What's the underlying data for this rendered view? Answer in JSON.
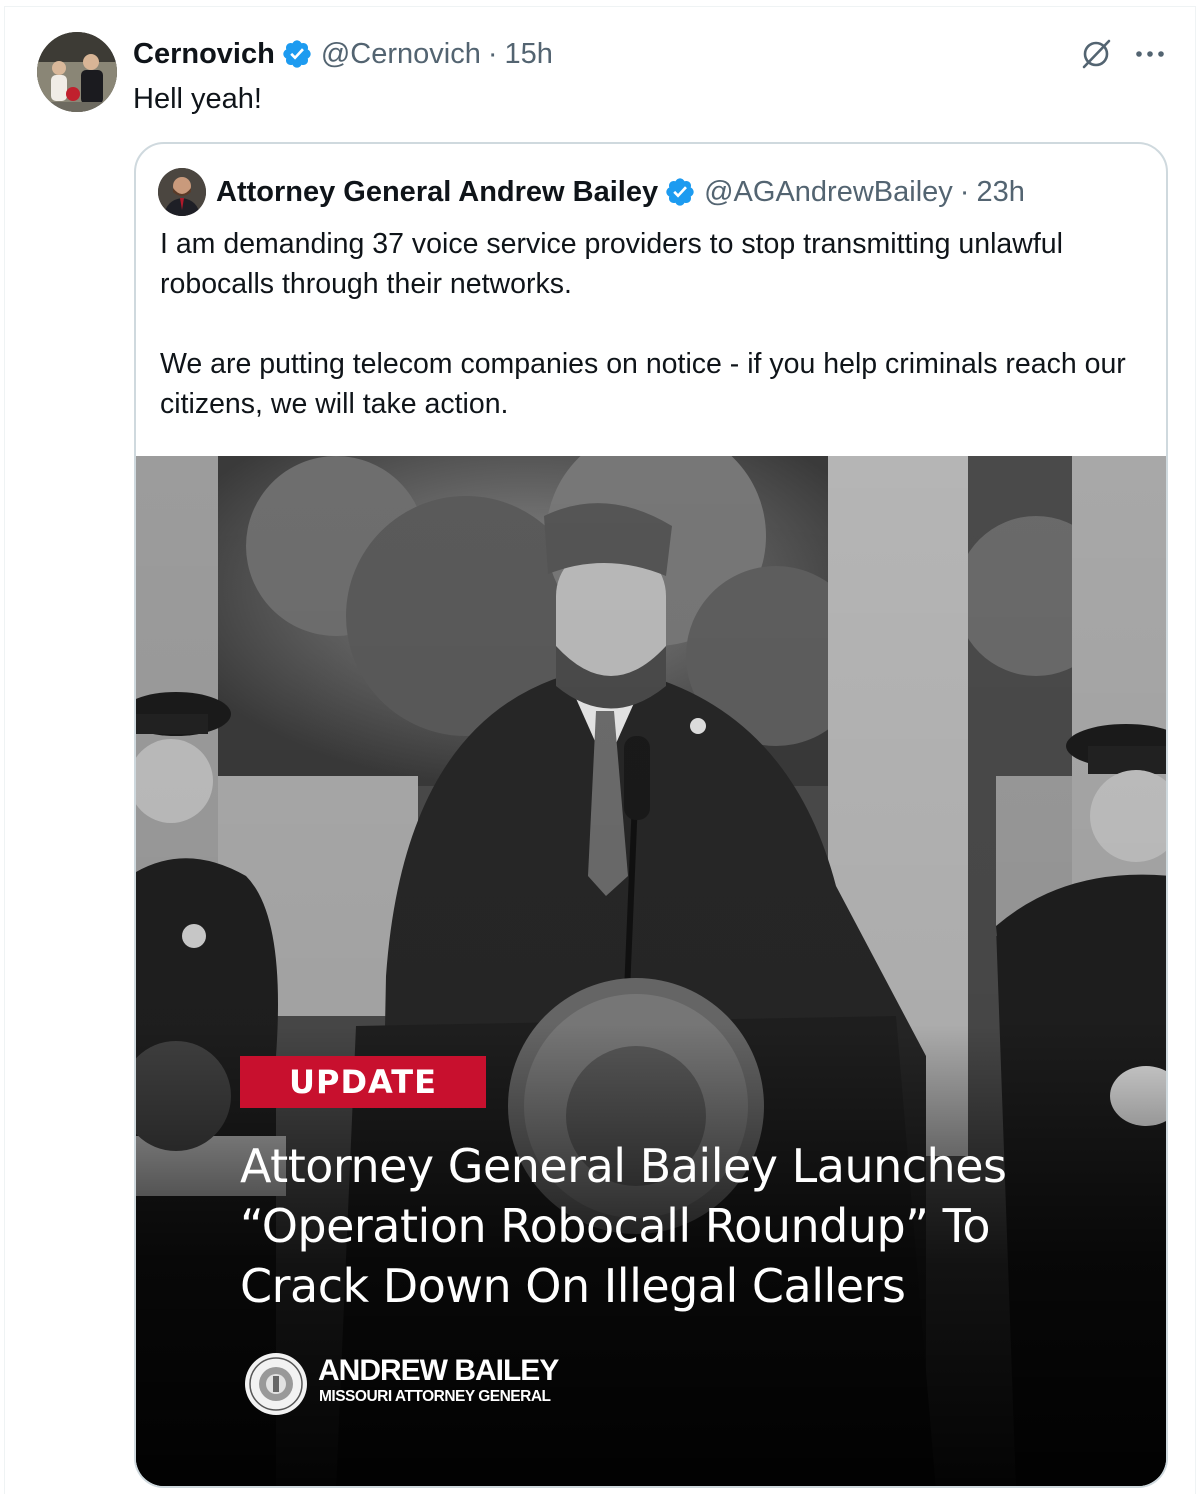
{
  "post": {
    "display_name": "Cernovich",
    "handle": "@Cernovich",
    "separator": "·",
    "time": "15h",
    "text": "Hell yeah!",
    "icons": {
      "avatar": "user-avatar",
      "verified": "verified-badge-icon",
      "grok": "grok-icon",
      "more": "more-icon"
    }
  },
  "quoted": {
    "display_name": "Attorney General Andrew Bailey",
    "handle": "@AGAndrewBailey",
    "separator": "·",
    "time": "23h",
    "paragraph_1": "I am demanding 37 voice service providers to stop transmitting unlawful robocalls through their networks.",
    "paragraph_2": "We are putting telecom companies on notice - if you help criminals reach our citizens, we will take action.",
    "image": {
      "badge": "UPDATE",
      "headline_line_1": "Attorney General Bailey Launches",
      "headline_line_2": "“Operation Robocall Roundup” To",
      "headline_line_3": "Crack Down On Illegal Callers",
      "brand_name": "ANDREW BAILEY",
      "brand_subtitle": "MISSOURI ATTORNEY GENERAL",
      "seal_text": "GREAT SEAL OF THE STATE OF MISSOURI"
    }
  },
  "colors": {
    "verified": "#1d9bf0",
    "secondary_text": "#536471",
    "badge": "#c8102e",
    "border": "#cfd9de"
  }
}
